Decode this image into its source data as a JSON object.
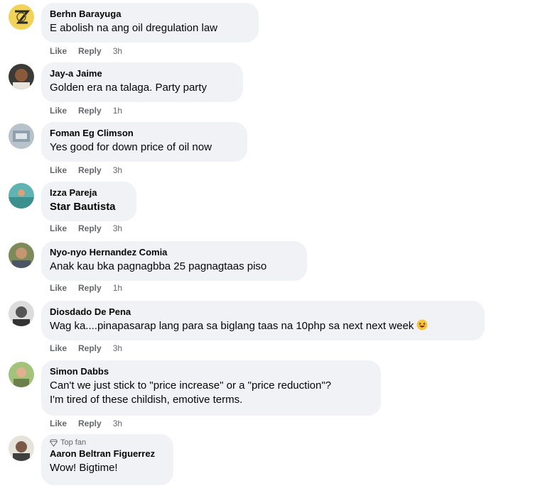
{
  "actions": {
    "like": "Like",
    "reply": "Reply"
  },
  "comments": [
    {
      "author": "Berhn Barayuga",
      "text": "E abolish na ang oil dregulation law",
      "time": "3h"
    },
    {
      "author": "Jay-a Jaime",
      "text": "Golden era na talaga. Party party",
      "time": "1h"
    },
    {
      "author": "Foman Eg Climson",
      "text": "Yes good for down price of oil now",
      "time": "3h"
    },
    {
      "author": "Izza Pareja",
      "text": "Star Bautista",
      "time": "3h"
    },
    {
      "author": "Nyo-nyo Hernandez Comia",
      "text": "Anak kau bka pagnagbba 25 pagnagtaas piso",
      "time": "1h"
    },
    {
      "author": "Diosdado De Pena",
      "text": "Wag ka....pinapasarap lang para sa biglang taas na 10php sa next next week",
      "time": "3h"
    },
    {
      "author": "Simon Dabbs",
      "text_line1": "Can't we just stick to \"price increase\" or a \"price reduction\"?",
      "text_line2": "I'm tired of these childish, emotive terms.",
      "time": "3h"
    },
    {
      "badge": "Top fan",
      "author": "Aaron Beltran Figuerrez",
      "text": "Wow! Bigtime!"
    }
  ],
  "icons": {
    "badge_icon": "diamond-icon",
    "emoji": "laughing-face-emoji"
  },
  "colors": {
    "bubble": "#f0f2f5",
    "secondary_text": "#65676b",
    "primary_text": "#050505"
  }
}
